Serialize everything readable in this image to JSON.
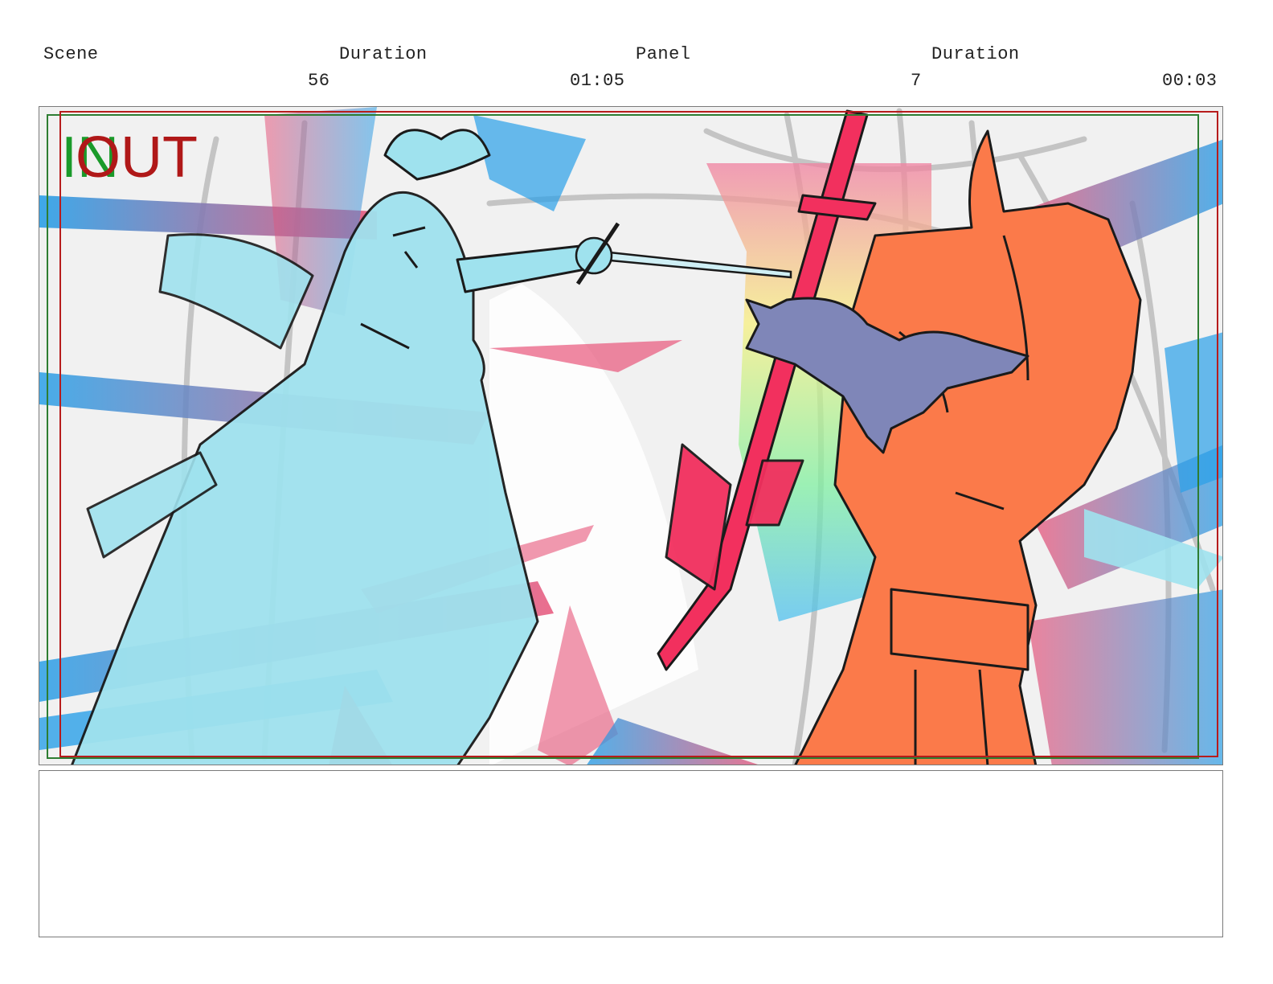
{
  "header": {
    "scene_label": "Scene",
    "scene_duration_label": "Duration",
    "panel_label": "Panel",
    "panel_duration_label": "Duration",
    "scene_value": "56",
    "scene_duration_value": "01:05",
    "panel_value": "7",
    "panel_duration_value": "00:03"
  },
  "markers": {
    "in_label": "IN",
    "out_label": "OUT",
    "in_color": "#1a9a2a",
    "out_color": "#b01818"
  },
  "colors": {
    "left_figure": "#9fe2ee",
    "right_figure": "#fb7a4a",
    "sword": "#f2305e",
    "creature": "#7f86b8",
    "streak_blue": "#2aa0e8",
    "streak_pink": "#e8557a",
    "safe_frame_green": "#2e7d32",
    "safe_frame_red": "#b71c1c"
  }
}
